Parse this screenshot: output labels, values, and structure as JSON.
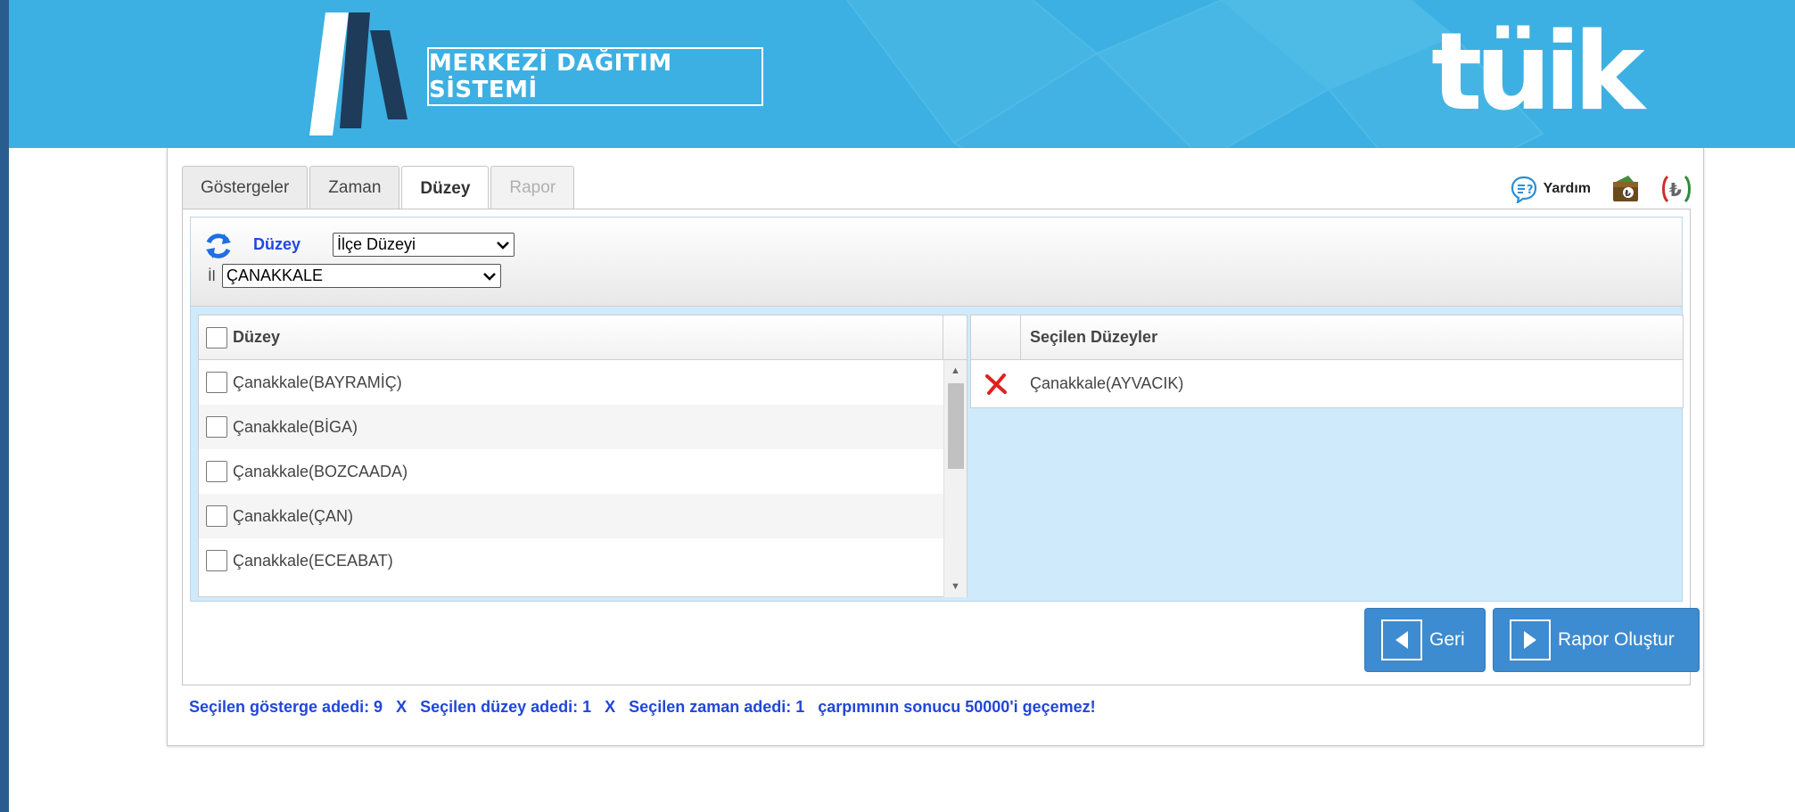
{
  "header": {
    "brand_text": "MERKEZİ DAĞITIM SİSTEMİ",
    "logo_text": "tüik"
  },
  "tabs": [
    {
      "label": "Göstergeler",
      "state": "normal"
    },
    {
      "label": "Zaman",
      "state": "normal"
    },
    {
      "label": "Düzey",
      "state": "active"
    },
    {
      "label": "Rapor",
      "state": "disabled"
    }
  ],
  "toolbar": {
    "help_label": "Yardım",
    "icons": [
      "help-bubble-icon",
      "wallet-icon",
      "lira-icon"
    ]
  },
  "filters": {
    "duzey_label": "Düzey",
    "duzey_select_value": "İlçe Düzeyi",
    "il_label": "İl",
    "il_select_value": "ÇANAKKALE"
  },
  "left_list": {
    "header": "Düzey",
    "items": [
      "Çanakkale(BAYRAMİÇ)",
      "Çanakkale(BİGA)",
      "Çanakkale(BOZCAADA)",
      "Çanakkale(ÇAN)",
      "Çanakkale(ECEABAT)"
    ]
  },
  "right_list": {
    "header": "Seçilen Düzeyler",
    "items": [
      "Çanakkale(AYVACIK)"
    ]
  },
  "buttons": {
    "back_label": "Geri",
    "create_report_label": "Rapor Oluştur"
  },
  "footer": {
    "note": "Seçilen gösterge adedi: 9   X   Seçilen düzey adedi: 1   X   Seçilen zaman adedi: 1   çarpımının sonucu 50000'i geçemez!"
  },
  "colors": {
    "header_bg": "#3cb0e2",
    "accent_blue": "#1f49e0",
    "button_blue": "#3d8bd0",
    "panel_light_blue": "#cfeafb"
  }
}
